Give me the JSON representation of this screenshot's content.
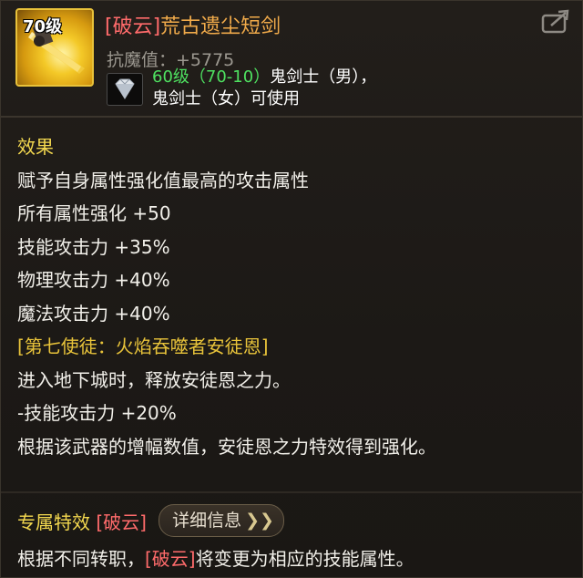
{
  "item": {
    "level_badge": "70级",
    "title_prefix": "[破云]",
    "title_name": "荒古遗尘短剑",
    "stat": "抗魔值：+5775",
    "req_level": "60级（70-10）",
    "req_line1_rest": "鬼剑士（男），",
    "req_line2": "鬼剑士（女）可使用",
    "accent_gold": "#e8c33a",
    "accent_red": "#ff6b6b",
    "accent_green": "#4ee060"
  },
  "effects": {
    "header": "效果",
    "lines": [
      "赋予自身属性强化值最高的攻击属性",
      "所有属性强化 +50",
      "技能攻击力 +35%",
      "物理攻击力 +40%",
      "魔法攻击力 +40%"
    ],
    "set_title": "[第七使徒：火焰吞噬者安徒恩]",
    "set_lines": [
      "进入地下城时，释放安徒恩之力。",
      "-技能攻击力 +20%",
      "根据该武器的增幅数值，安徒恩之力特效得到强化。"
    ]
  },
  "footer": {
    "title": "专属特效",
    "title_tag": "[破云]",
    "detail_button": "详细信息",
    "line_start": "根据不同转职，",
    "line_tag": "[破云]",
    "line_end": "将变更为相应的技能属性。"
  },
  "icons": {
    "share": "share-icon",
    "gem": "diamond-icon",
    "item": "sword-icon",
    "chevron": "double-chevron-right-icon"
  }
}
